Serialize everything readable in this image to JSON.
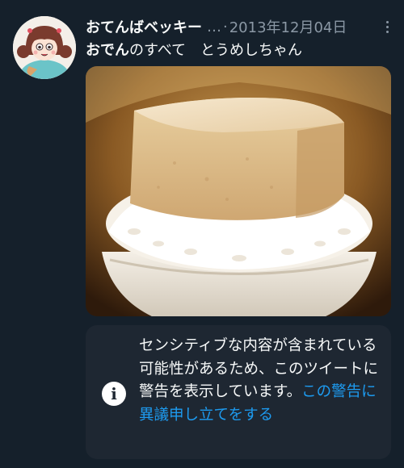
{
  "tweet": {
    "author_name": "おてんばベッキー",
    "truncation": "…",
    "separator": "·",
    "date": "2013年12月04日",
    "text_bold": "おでん",
    "text_rest": "のすべて　とうめしちゃん"
  },
  "media": {
    "description_icon": "photo"
  },
  "warning": {
    "text": "センシティブな内容が含まれている可能性があるため、このツイートに警告を表示しています。",
    "link_text": "この警告に異議申し立てをする",
    "icon": "info-icon"
  },
  "colors": {
    "background": "#15202b",
    "notice_background": "#1e2732",
    "link": "#1d9bf0",
    "secondary_text": "#8b98a5"
  }
}
